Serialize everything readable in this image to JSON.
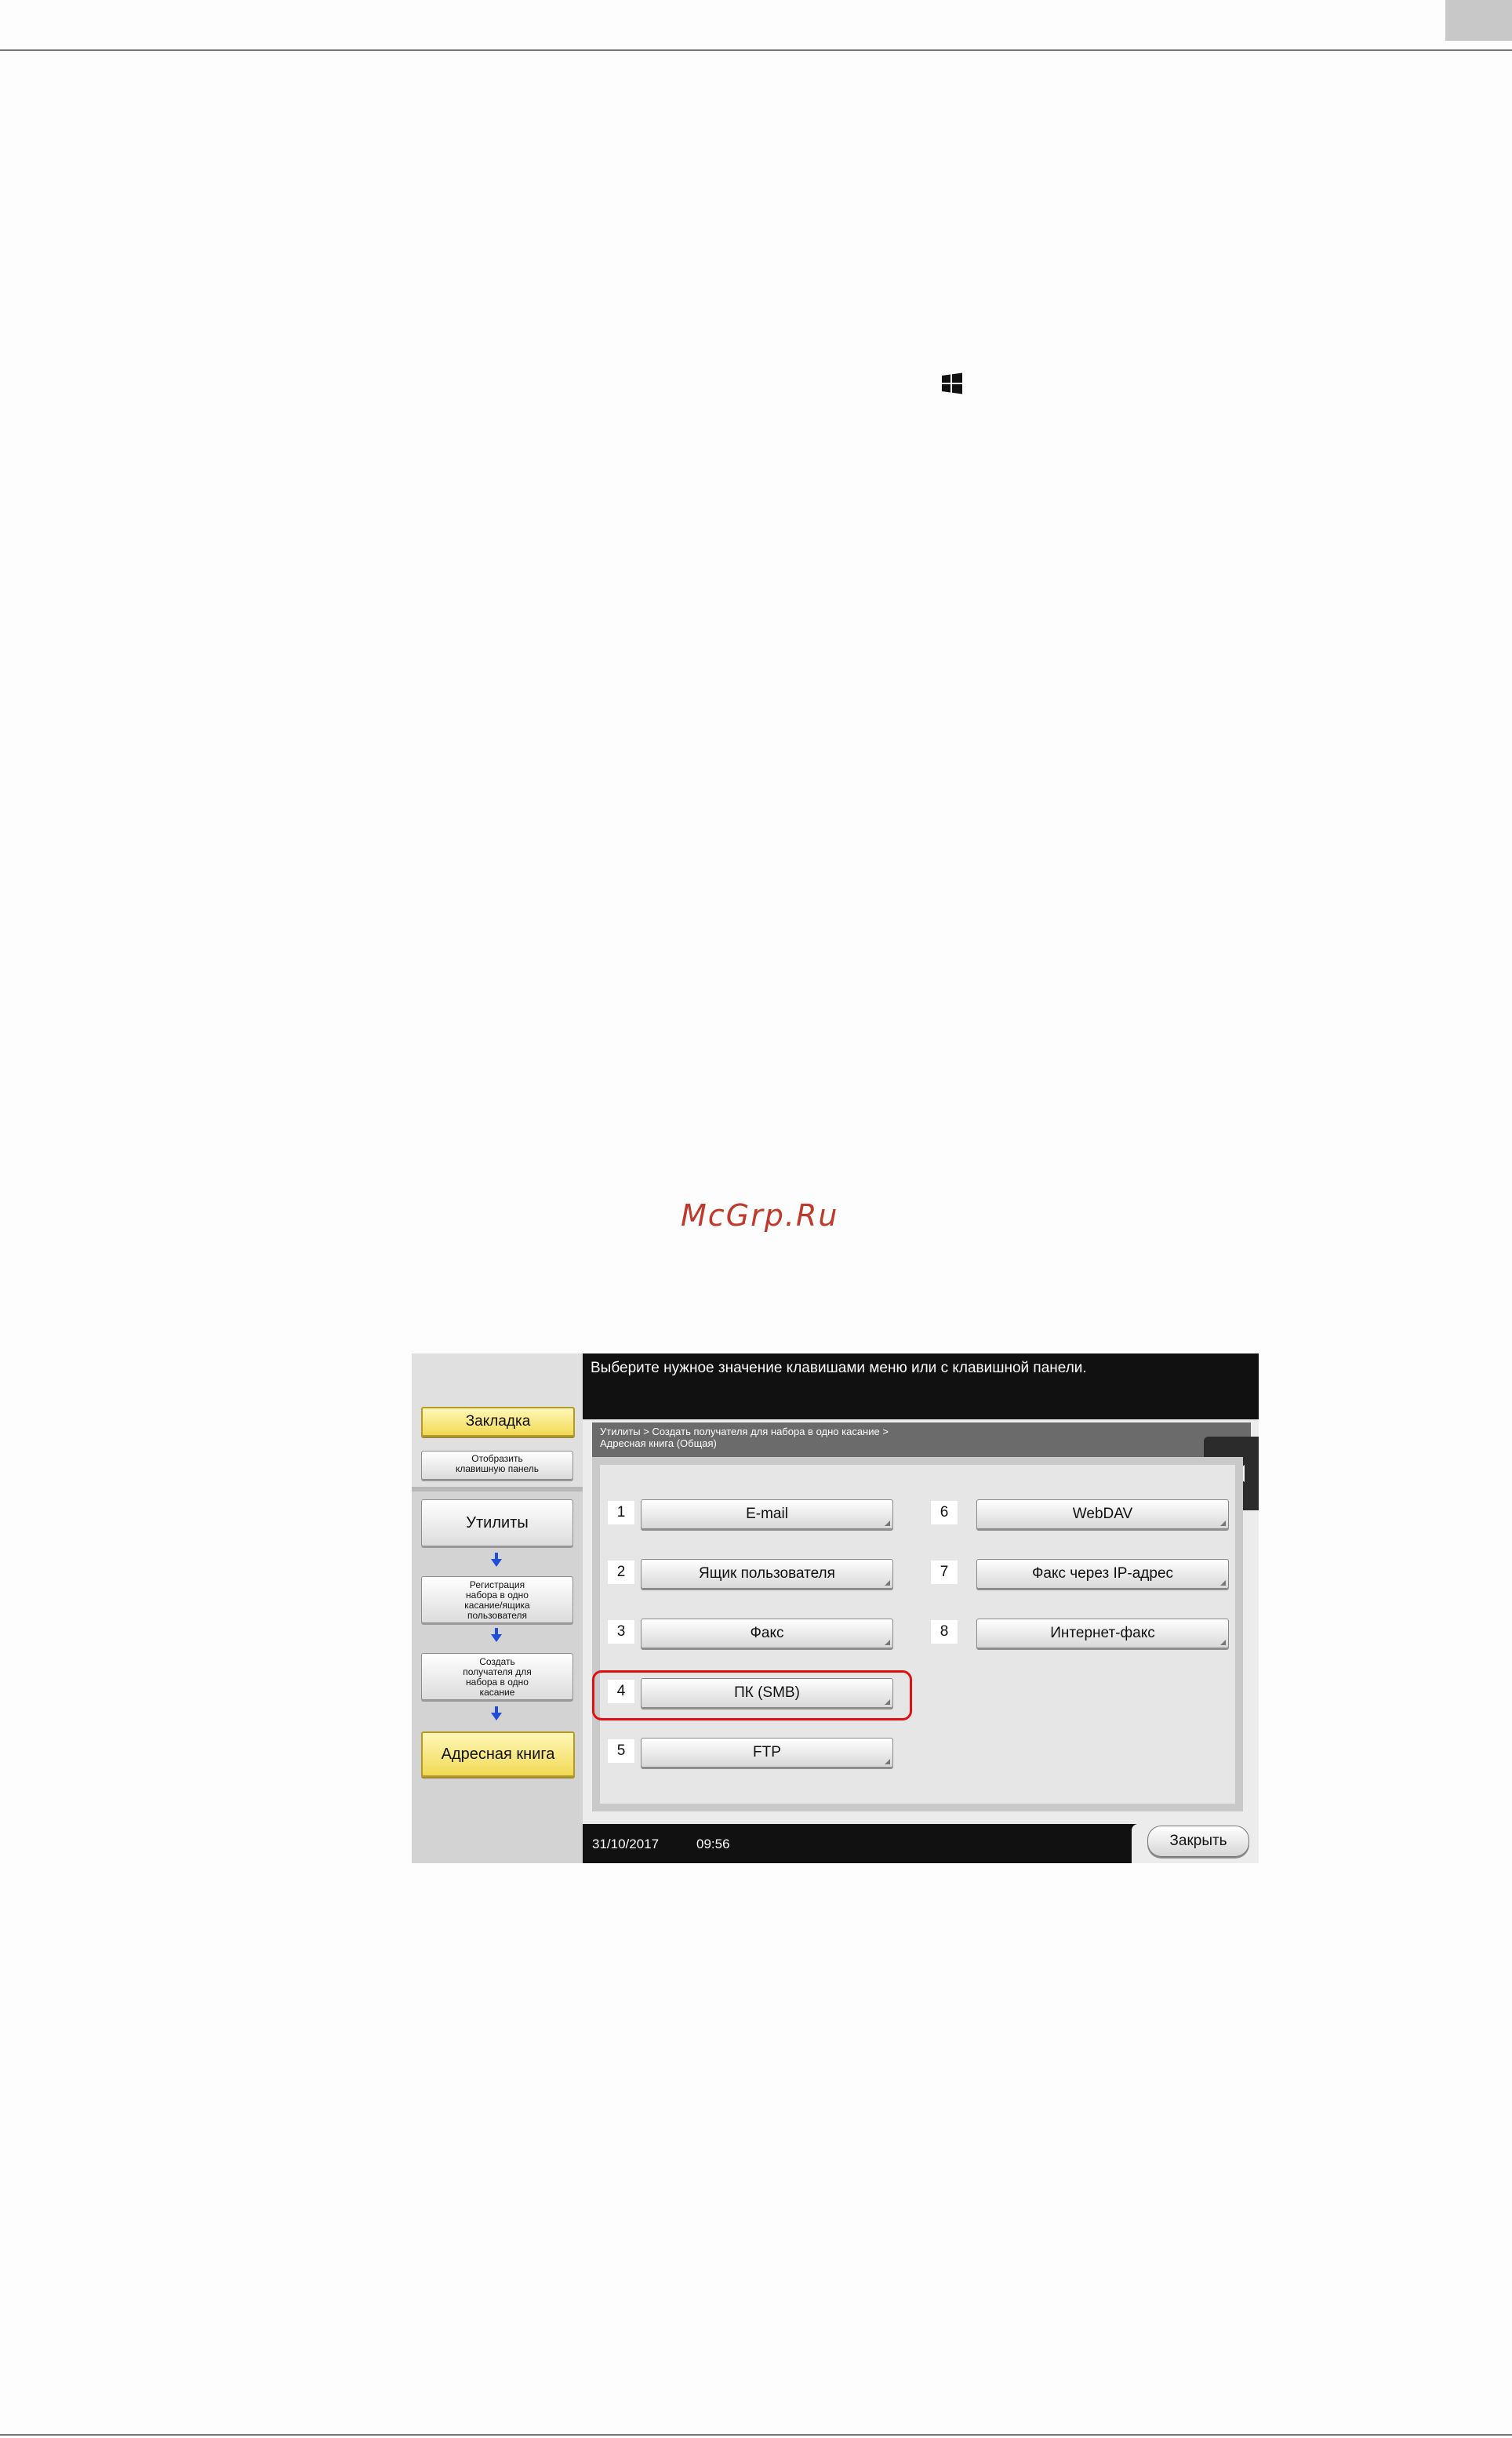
{
  "watermark": "McGrp.Ru",
  "panel": {
    "top_message": "Выберите нужное значение клавишами меню или с клавишной панели.",
    "breadcrumb": {
      "line1": "Утилиты > Создать получателя для набора в одно касание >",
      "line2": "Адресная книга (Общая)"
    },
    "sidebar": {
      "bookmark": "Закладка",
      "show_keypad": [
        "Отобразить",
        "клавишную панель"
      ],
      "utilities": "Утилиты",
      "step1": [
        "Регистрация",
        "набора в одно",
        "касание/ящика",
        "пользователя"
      ],
      "step2": [
        "Создать",
        "получателя для",
        "набора в одно",
        "касание"
      ],
      "address_book": "Адресная книга"
    },
    "items": [
      {
        "num": "1",
        "label": "E-mail"
      },
      {
        "num": "2",
        "label": "Ящик пользователя"
      },
      {
        "num": "3",
        "label": "Факс"
      },
      {
        "num": "4",
        "label": "ПК (SMB)"
      },
      {
        "num": "5",
        "label": "FTP"
      },
      {
        "num": "6",
        "label": "WebDAV"
      },
      {
        "num": "7",
        "label": "Факс через IP-адрес"
      },
      {
        "num": "8",
        "label": "Интернет-факс"
      }
    ],
    "status": {
      "date": "31/10/2017",
      "time": "09:56"
    },
    "close_label": "Закрыть"
  },
  "colors": {
    "highlight": "#e01010",
    "watermark": "#c0392b",
    "yellow": "#f1da55"
  }
}
